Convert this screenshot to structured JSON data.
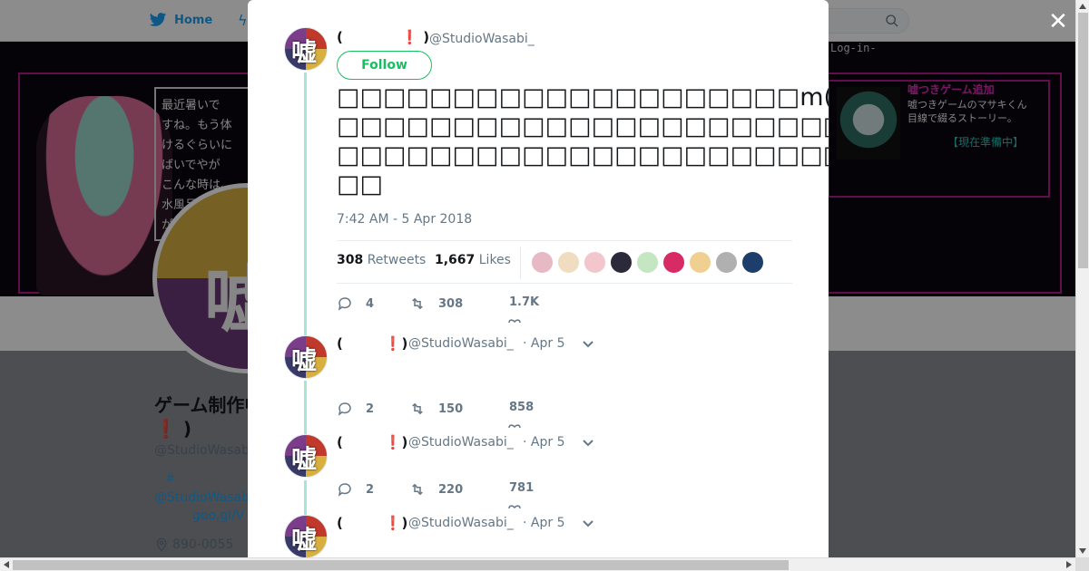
{
  "colors": {
    "twitter_blue": "#1da1f2",
    "follow_green": "#17bf63",
    "thread_line": "#a5e6d8",
    "banner_magenta": "#b2188a"
  },
  "topbar": {
    "home_label": "Home",
    "home_icon": "twitter-bird-icon",
    "search_icon": "search-icon"
  },
  "banner": {
    "login_text": "Log-in-",
    "note_text": "最近暑いで\nすね。もう体\nけるぐらいに\nばいでやが\nこんな時は、\n水風呂\nが",
    "promo_heading": "嘘つきゲーム追加",
    "promo_text": "嘘つきゲームのマサキくん\n目線で綴るストーリー。",
    "promo_status": "【現在準備中】"
  },
  "profile": {
    "name": "ゲーム制作中(嘘",
    "name_bang": "❗",
    "name_close": ")",
    "handle": "@StudioWasabi",
    "bio_tag": "#",
    "bio_link": "@StudioWasab",
    "bio_url": "goo.gl/V",
    "location": "890-0055",
    "location_icon": "location-pin-icon"
  },
  "modal": {
    "close_icon": "close-icon",
    "main_tweet": {
      "name_open": "(",
      "name_bang": "❗",
      "name_close": ")",
      "handle": "@StudioWasabi_",
      "follow_label": "Follow",
      "text": "□□□□□□□□□□□□□□□□□□□□m(_ _)m\n□□□□□□□□□□□□□□□□□□□□□□□□□□□□□□□□□□□□□□□□□□□□\n□□□□□□□□□□□□□□□□□□□□□□□□□□□□□□□□□□□□□□□□□□□\n□□",
      "timestamp": "7:42 AM - 5 Apr 2018",
      "retweets_count": "308",
      "retweets_label": "Retweets",
      "likes_count": "1,667",
      "likes_label": "Likes",
      "liker_colors": [
        "#e7b9c4",
        "#f0dcc0",
        "#f2c6cc",
        "#2a2a3a",
        "#c4e6c0",
        "#d82a64",
        "#f0d090",
        "#b0b0b0",
        "#1d3d6a"
      ],
      "reply_count": "4",
      "retweet_count": "308",
      "like_count": "1.7K"
    },
    "replies": [
      {
        "name_open": "(",
        "name_bang": "❗",
        "name_close": ")",
        "handle": "@StudioWasabi_",
        "date": "· Apr 5",
        "reply_count": "2",
        "retweet_count": "150",
        "like_count": "858"
      },
      {
        "name_open": "(",
        "name_bang": "❗",
        "name_close": ")",
        "handle": "@StudioWasabi_",
        "date": "· Apr 5",
        "reply_count": "2",
        "retweet_count": "220",
        "like_count": "781"
      },
      {
        "name_open": "(",
        "name_bang": "❗",
        "name_close": ")",
        "handle": "@StudioWasabi_",
        "date": "· Apr 5"
      }
    ],
    "avatar_glyph": "嘘"
  }
}
